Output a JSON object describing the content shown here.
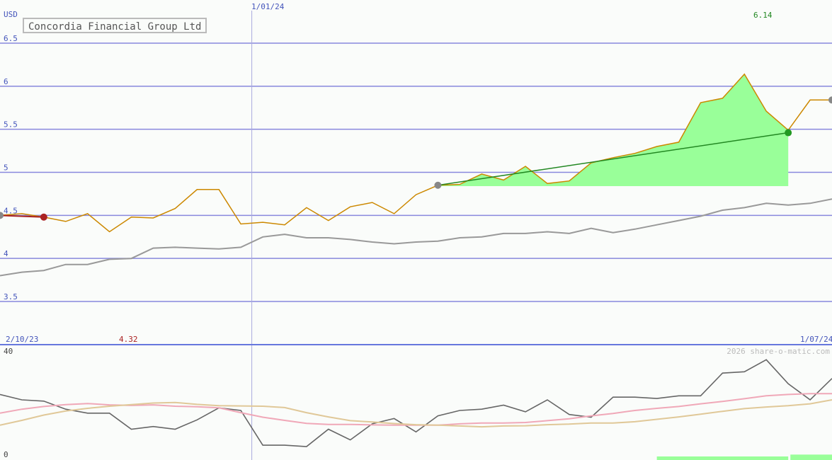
{
  "title": "Concordia Financial Group Ltd",
  "currency": "USD",
  "watermark": "2026 share-o-matic.com",
  "colors": {
    "background": "#fafcfa",
    "gridline": "#8888dd",
    "axis_text": "#4455bb",
    "price_line": "#cc8800",
    "moving_average": "#999999",
    "trend_fill": "#99ff99",
    "trend_line": "#228822",
    "down_trend": "#aa2222",
    "peak_label": "#228822",
    "low_label": "#aa2222",
    "osc_line": "#666666",
    "osc_fast": "#f0a8b8",
    "osc_slow": "#e0c898"
  },
  "chart_data": [
    {
      "type": "line",
      "title": "Concordia Financial Group Ltd",
      "ylabel": "USD",
      "ylim": [
        3.5,
        6.5
      ],
      "yticks": [
        3.5,
        4,
        4.5,
        5,
        5.5,
        6,
        6.5
      ],
      "ytick_labels": [
        "3.5",
        "4",
        "4.5",
        "5",
        "5.5",
        "6",
        "6.5"
      ],
      "x_labels": {
        "start": "2/10/23",
        "marker": "1/01/24",
        "end": "1/07/24"
      },
      "marker_index": 11.5,
      "grid": true,
      "x": [
        0,
        1,
        2,
        3,
        4,
        5,
        6,
        7,
        8,
        9,
        10,
        11,
        12,
        13,
        14,
        15,
        16,
        17,
        18,
        19,
        20,
        21,
        22,
        23,
        24,
        25,
        26,
        27,
        28,
        29,
        30,
        31,
        32,
        33,
        34,
        35,
        36,
        37,
        38
      ],
      "series": [
        {
          "role": "price",
          "values": [
            4.5,
            4.52,
            4.48,
            4.43,
            4.52,
            4.31,
            4.48,
            4.47,
            4.58,
            4.8,
            4.8,
            4.4,
            4.42,
            4.39,
            4.59,
            4.44,
            4.6,
            4.65,
            4.52,
            4.74,
            4.85,
            4.86,
            4.98,
            4.91,
            5.07,
            4.87,
            4.9,
            5.11,
            5.17,
            5.22,
            5.3,
            5.35,
            5.81,
            5.86,
            6.14,
            5.71,
            5.49,
            5.84,
            5.84
          ]
        },
        {
          "role": "moving_average",
          "values": [
            3.8,
            3.84,
            3.86,
            3.93,
            3.93,
            3.99,
            4.0,
            4.12,
            4.13,
            4.12,
            4.11,
            4.13,
            4.25,
            4.28,
            4.24,
            4.24,
            4.22,
            4.19,
            4.17,
            4.19,
            4.2,
            4.24,
            4.25,
            4.29,
            4.29,
            4.31,
            4.29,
            4.35,
            4.3,
            4.34,
            4.39,
            4.44,
            4.49,
            4.56,
            4.59,
            4.64,
            4.62,
            4.64,
            4.69
          ]
        }
      ],
      "annotations": {
        "peak_label": "6.14",
        "low_label": "4.32",
        "uptrend": {
          "from_index": 20,
          "to_index": 36,
          "from_value": 4.85,
          "to_value": 5.46
        },
        "downtrend": {
          "from_index": 0,
          "to_index": 2,
          "from_value": 4.5,
          "to_value": 4.48
        },
        "points": [
          {
            "index": 0,
            "value": 4.5,
            "color": "#888888"
          },
          {
            "index": 2,
            "value": 4.48,
            "color": "#aa2222"
          },
          {
            "index": 20,
            "value": 4.85,
            "color": "#888888"
          },
          {
            "index": 36,
            "value": 5.46,
            "color": "#229922"
          },
          {
            "index": 38,
            "value": 5.84,
            "color": "#888888"
          }
        ]
      }
    },
    {
      "type": "line",
      "ylim": [
        0,
        40
      ],
      "ytick_labels": [
        "40",
        "0"
      ],
      "series": [
        {
          "role": "oscillator",
          "values": [
            24,
            22,
            21.5,
            18.5,
            17,
            17,
            11,
            12,
            11,
            14.5,
            19,
            18,
            5,
            5,
            4.5,
            11,
            7,
            13,
            15,
            10,
            16,
            18,
            18.5,
            20,
            17.5,
            22,
            16.5,
            15.5,
            23,
            23,
            22.5,
            23.5,
            23.5,
            32,
            32.5,
            37,
            28,
            22,
            30
          ]
        },
        {
          "role": "signal_fast",
          "values": [
            17,
            18.5,
            19.5,
            20.2,
            20.6,
            20.1,
            19.9,
            20.1,
            19.6,
            19.4,
            19,
            17.2,
            15.5,
            14.3,
            13.2,
            12.8,
            12.8,
            12.6,
            12.5,
            12.5,
            12.5,
            13,
            13.3,
            13.3,
            13.5,
            14.2,
            14.9,
            16,
            16.9,
            18,
            18.8,
            19.5,
            20.5,
            21.4,
            22.4,
            23.5,
            24,
            24.3,
            24.3
          ]
        },
        {
          "role": "signal_slow",
          "values": [
            12.5,
            14.3,
            16.3,
            17.8,
            18.8,
            19.6,
            20.2,
            20.8,
            21,
            20.3,
            19.8,
            19.7,
            19.6,
            19.1,
            17.2,
            15.6,
            14.2,
            13.7,
            13.1,
            12.7,
            12.5,
            12.2,
            11.9,
            12.2,
            12.3,
            12.7,
            12.9,
            13.3,
            13.3,
            13.8,
            14.7,
            15.6,
            16.6,
            17.7,
            18.7,
            19.3,
            19.8,
            20.5,
            22
          ]
        }
      ],
      "volume_bars": [
        {
          "from_index": 30,
          "to_index": 36,
          "value": 0.8
        },
        {
          "from_index": 36.1,
          "to_index": 38,
          "value": 1.5
        }
      ]
    }
  ]
}
